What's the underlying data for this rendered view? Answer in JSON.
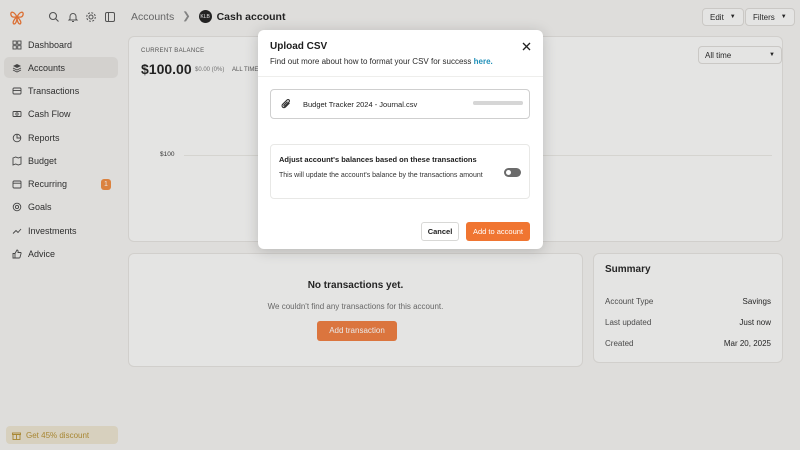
{
  "sidebar": {
    "logo_icon": "butterfly-logo-icon",
    "top_icons": [
      "search-icon",
      "bell-icon",
      "gear-icon",
      "sidebar-toggle-icon"
    ],
    "items": [
      {
        "label": "Dashboard",
        "icon": "dashboard-icon"
      },
      {
        "label": "Accounts",
        "icon": "layers-icon",
        "active": true
      },
      {
        "label": "Transactions",
        "icon": "receipt-icon"
      },
      {
        "label": "Cash Flow",
        "icon": "cash-flow-icon"
      },
      {
        "label": "Reports",
        "icon": "pie-chart-icon"
      },
      {
        "label": "Budget",
        "icon": "map-icon"
      },
      {
        "label": "Recurring",
        "icon": "calendar-icon",
        "badge": "1"
      },
      {
        "label": "Goals",
        "icon": "target-icon"
      },
      {
        "label": "Investments",
        "icon": "trending-up-icon"
      },
      {
        "label": "Advice",
        "icon": "thumbs-up-icon"
      }
    ],
    "promo": {
      "label": "Get 45% discount",
      "icon": "gift-icon"
    }
  },
  "header": {
    "breadcrumb_root": "Accounts",
    "account_avatar": "KLB",
    "account_name": "Cash account",
    "edit_label": "Edit",
    "filters_label": "Filters"
  },
  "balance": {
    "label": "CURRENT BALANCE",
    "value": "$100.00",
    "change": "$0.00 (0%)",
    "period": "ALL TIME",
    "range": "All time",
    "y_tick": "$100"
  },
  "transactions": {
    "title": "No transactions yet.",
    "subtitle": "We couldn't find any transactions for this account.",
    "add_label": "Add transaction"
  },
  "summary": {
    "title": "Summary",
    "rows": [
      {
        "label": "Account Type",
        "value": "Savings"
      },
      {
        "label": "Last updated",
        "value": "Just now"
      },
      {
        "label": "Created",
        "value": "Mar 20, 2025"
      }
    ]
  },
  "modal": {
    "title": "Upload CSV",
    "subtitle": "Find out more about how to format your CSV for success",
    "link": "here.",
    "file_name": "Budget Tracker 2024 - Journal.csv",
    "upload_progress": 1.0,
    "adjust_title": "Adjust account's balances based on these transactions",
    "adjust_desc": "This will update the account's balance by the transactions amount",
    "adjust_enabled": false,
    "cancel_label": "Cancel",
    "add_label": "Add to account"
  },
  "colors": {
    "accent": "#f07531",
    "link": "#1f8fb8",
    "badge": "#f08a3e",
    "promo_text": "#b58f2f"
  }
}
